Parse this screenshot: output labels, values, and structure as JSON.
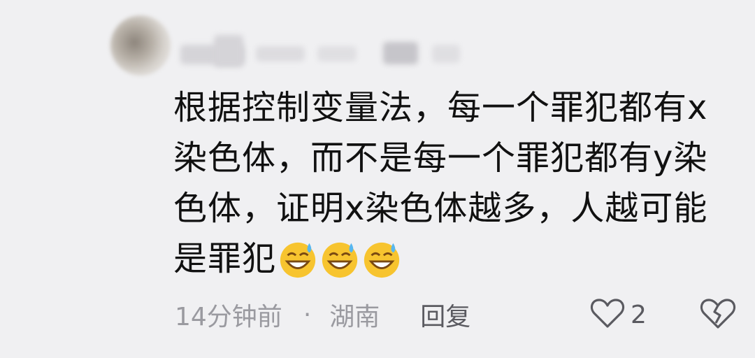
{
  "comment": {
    "text": "根据控制变量法，每一个罪犯都有x染色体，而不是每一个罪犯都有y染色体，证明x染色体越多，人越可能是罪犯",
    "emojis": [
      "grinning-sweat-emoji",
      "grinning-sweat-emoji",
      "grinning-sweat-emoji"
    ],
    "time": "14分钟前",
    "separator": "·",
    "location": "湖南",
    "reply_label": "回复",
    "like_count": "2"
  },
  "colors": {
    "background": "#f0f0f2",
    "text": "#111111",
    "meta": "#9a9aa0",
    "action": "#5a5a60"
  }
}
